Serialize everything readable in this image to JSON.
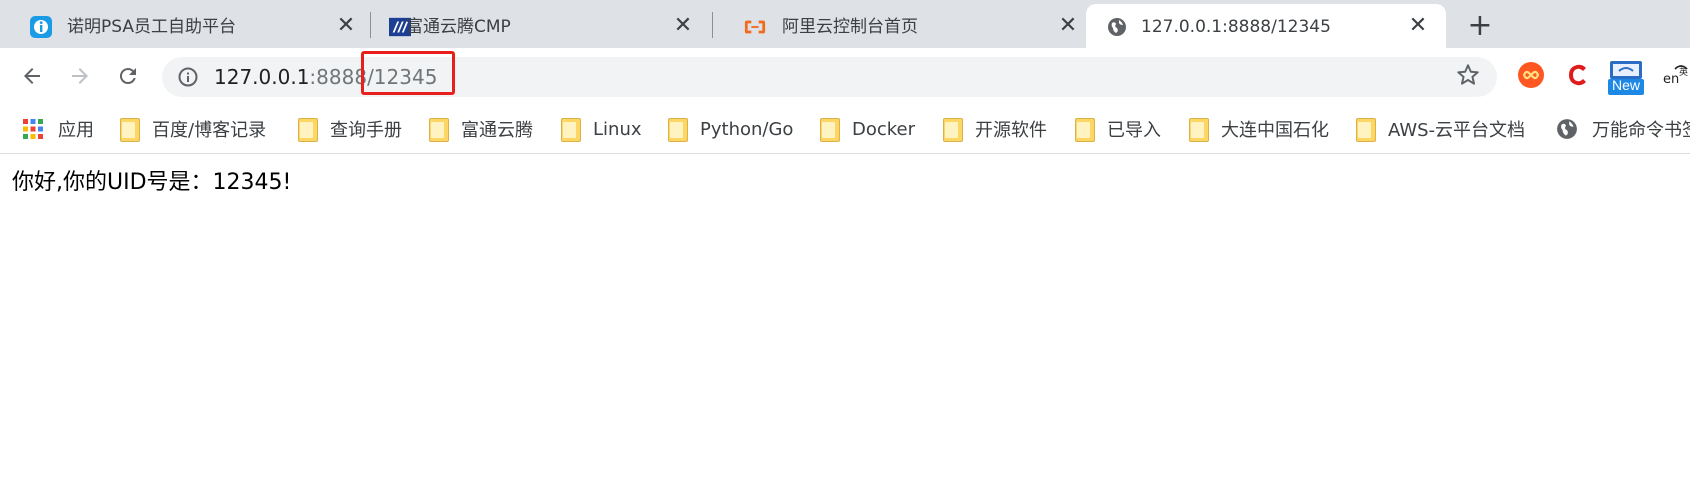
{
  "tabs": [
    {
      "title": "诺明PSA员工自助平台",
      "active": false,
      "icon": "info-badge-icon"
    },
    {
      "title": "富通云腾CMP",
      "active": false,
      "icon": "cmp-logo-icon"
    },
    {
      "title": "阿里云控制台首页",
      "active": false,
      "icon": "aliyun-logo-icon"
    },
    {
      "title": "127.0.0.1:8888/12345",
      "active": true,
      "icon": "globe-icon"
    }
  ],
  "omnibox": {
    "host": "127.0.0.1",
    "port": ":8888",
    "path": "/12345"
  },
  "extensions": {
    "new_badge": "New"
  },
  "bookmarks": {
    "apps_label": "应用",
    "items": [
      "百度/博客记录",
      "查询手册",
      "富通云腾",
      "Linux",
      "Python/Go",
      "Docker",
      "开源软件",
      "已导入",
      "大连中国石化",
      "AWS-云平台文档",
      "万能命令书签"
    ]
  },
  "page": {
    "message": "你好,你的UID号是：12345!"
  },
  "colors": {
    "tabstrip": "#dee1e6",
    "highlight": "#e8201c",
    "omnibox": "#f1f3f4"
  }
}
